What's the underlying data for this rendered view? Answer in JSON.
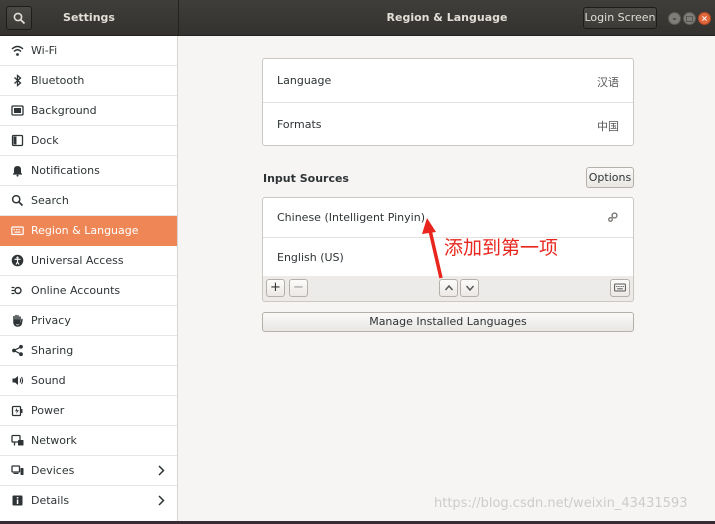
{
  "header": {
    "sidebar_title": "Settings",
    "main_title": "Region & Language",
    "login_screen_label": "Login Screen"
  },
  "sidebar": {
    "items": [
      {
        "label": "Wi-Fi",
        "icon": "wifi-icon"
      },
      {
        "label": "Bluetooth",
        "icon": "bluetooth-icon"
      },
      {
        "label": "Background",
        "icon": "background-icon"
      },
      {
        "label": "Dock",
        "icon": "dock-icon"
      },
      {
        "label": "Notifications",
        "icon": "bell-icon"
      },
      {
        "label": "Search",
        "icon": "search-icon"
      },
      {
        "label": "Region & Language",
        "icon": "keyboard-icon",
        "active": true
      },
      {
        "label": "Universal Access",
        "icon": "accessibility-icon"
      },
      {
        "label": "Online Accounts",
        "icon": "online-accounts-icon"
      },
      {
        "label": "Privacy",
        "icon": "hand-icon"
      },
      {
        "label": "Sharing",
        "icon": "share-icon"
      },
      {
        "label": "Sound",
        "icon": "speaker-icon"
      },
      {
        "label": "Power",
        "icon": "power-icon"
      },
      {
        "label": "Network",
        "icon": "network-icon"
      },
      {
        "label": "Devices",
        "icon": "devices-icon",
        "has_submenu": true
      },
      {
        "label": "Details",
        "icon": "info-icon",
        "has_submenu": true
      }
    ]
  },
  "language_panel": {
    "language_label": "Language",
    "language_value": "汉语",
    "formats_label": "Formats",
    "formats_value": "中国"
  },
  "input_sources": {
    "title": "Input Sources",
    "options_label": "Options",
    "sources": [
      {
        "label": "Chinese (Intelligent Pinyin)"
      },
      {
        "label": "English (US)"
      }
    ],
    "add_label": "+",
    "remove_label": "−",
    "manage_label": "Manage Installed Languages"
  },
  "annotation": {
    "text": "添加到第一项",
    "color": "#e8261d"
  },
  "watermark": "https://blog.csdn.net/weixin_43431593",
  "colors": {
    "accent": "#ef8656",
    "headerbar": "#3a3935"
  }
}
